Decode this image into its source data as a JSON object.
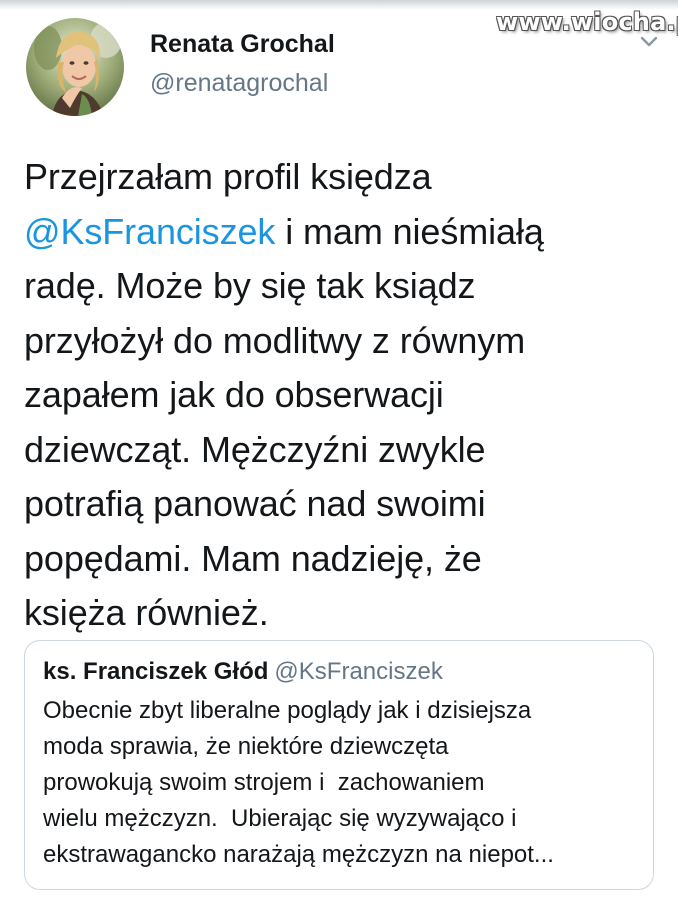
{
  "watermark": "www.wiocha.pl",
  "icons": {
    "chevron": "chevron-down-icon",
    "avatar": "avatar-photo"
  },
  "colors": {
    "link": "#1b95e0",
    "secondary": "#657786",
    "text": "#14171a",
    "border": "#ccd6dd"
  },
  "tweet": {
    "author_name": "Renata Grochal",
    "author_handle": "@renatagrochal",
    "text_before": "Przejrzałam profil księdza\n",
    "mention": "@KsFranciszek",
    "text_after": " i mam nieśmiałą\nradę. Może by się tak ksiądz\nprzyłożył do modlitwy z równym\nzapałem jak do obserwacji\ndziewcząt. Mężczyźni zwykle\npotrafią panować nad swoimi\npopędami. Mam nadzieję, że\nksięża również."
  },
  "quoted_tweet": {
    "author_name": "ks. Franciszek Głód",
    "author_handle": "@KsFranciszek",
    "text": "Obecnie zbyt liberalne poglądy jak i dzisiejsza\nmoda sprawia, że niektóre dziewczęta\nprowokują swoim strojem i  zachowaniem\nwielu mężczyzn.  Ubierając się wyzywająco i\nekstrawagancko narażają mężczyzn na niepot..."
  }
}
